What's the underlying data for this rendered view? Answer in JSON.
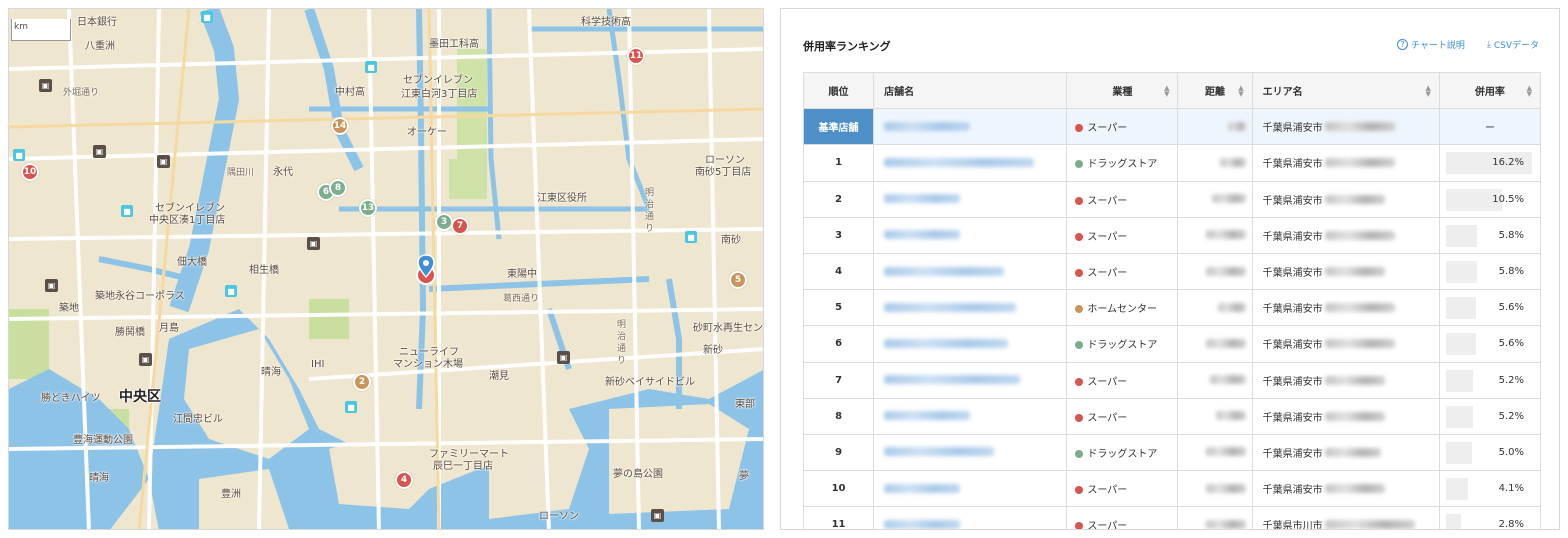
{
  "map": {
    "scale_unit": "km",
    "labels": [
      {
        "id": "nihonginko",
        "text": "日本銀行"
      },
      {
        "id": "kagaku",
        "text": "科学技術高"
      },
      {
        "id": "yaesu",
        "text": "八重洲"
      },
      {
        "id": "sotobori",
        "text": "外堀通り"
      },
      {
        "id": "sumidakou",
        "text": "墨田工科高"
      },
      {
        "id": "nakamura",
        "text": "中村高"
      },
      {
        "id": "seven1",
        "text": "セブンイレブン"
      },
      {
        "id": "seven1b",
        "text": "江東白河3丁目店"
      },
      {
        "id": "okei",
        "text": "オーケー"
      },
      {
        "id": "sumidagawa",
        "text": "隅田川"
      },
      {
        "id": "eitai",
        "text": "永代"
      },
      {
        "id": "seven2",
        "text": "セブンイレブン"
      },
      {
        "id": "seven2b",
        "text": "中央区湊1丁目店"
      },
      {
        "id": "lawson1",
        "text": "ローソン"
      },
      {
        "id": "lawson1b",
        "text": "南砂5丁目店"
      },
      {
        "id": "koto",
        "text": "江東区役所"
      },
      {
        "id": "meiji1",
        "text": "明治通り"
      },
      {
        "id": "minamisuna",
        "text": "南砂"
      },
      {
        "id": "tsukuda",
        "text": "佃大橋"
      },
      {
        "id": "aioi",
        "text": "相生橋"
      },
      {
        "id": "toyochu",
        "text": "東陽中"
      },
      {
        "id": "tsukiji",
        "text": "築地"
      },
      {
        "id": "tsukijiriver",
        "text": "築地永谷コーポラス"
      },
      {
        "id": "eitaidori",
        "text": "葛西通り"
      },
      {
        "id": "kachidoki",
        "text": "勝鬨橋"
      },
      {
        "id": "tsukishima",
        "text": "月島"
      },
      {
        "id": "sunamachi",
        "text": "砂町水再生セン"
      },
      {
        "id": "meiji2",
        "text": "明治通り"
      },
      {
        "id": "shinsuna",
        "text": "新砂"
      },
      {
        "id": "harumi",
        "text": "晴海"
      },
      {
        "id": "ihi",
        "text": "IHI"
      },
      {
        "id": "newlife",
        "text": "ニューライフ"
      },
      {
        "id": "newlifeb",
        "text": "マンション木場"
      },
      {
        "id": "shiomi",
        "text": "潮見"
      },
      {
        "id": "shinsunabay",
        "text": "新砂ベイサイドビル"
      },
      {
        "id": "kachidokiheights",
        "text": "勝どきハイツ"
      },
      {
        "id": "chuoku",
        "text": "中央区"
      },
      {
        "id": "edomi",
        "text": "江間忠ビル"
      },
      {
        "id": "toyosu",
        "text": "豊海運動公園"
      },
      {
        "id": "harumi2",
        "text": "晴海"
      },
      {
        "id": "toyosu2",
        "text": "豊洲"
      },
      {
        "id": "famima",
        "text": "ファミリーマート"
      },
      {
        "id": "famimab",
        "text": "辰巳一丁目店"
      },
      {
        "id": "yumenoshima",
        "text": "夢の島公園"
      },
      {
        "id": "tobu",
        "text": "東部"
      },
      {
        "id": "yume",
        "text": "夢"
      },
      {
        "id": "lawson2",
        "text": "ローソン"
      }
    ],
    "markers": [
      {
        "num": "11",
        "color": "#d9534f"
      },
      {
        "num": "10",
        "color": "#d9534f"
      },
      {
        "num": "14",
        "color": "#c8955a"
      },
      {
        "num": "6",
        "color": "#7cae8e"
      },
      {
        "num": "8",
        "color": "#7cae8e"
      },
      {
        "num": "13",
        "color": "#7cae8e"
      },
      {
        "num": "3",
        "color": "#7cae8e"
      },
      {
        "num": "7",
        "color": "#d9534f"
      },
      {
        "num": "5",
        "color": "#c8955a"
      },
      {
        "num": "2",
        "color": "#c8955a"
      },
      {
        "num": "4",
        "color": "#d9534f"
      }
    ]
  },
  "ranking": {
    "title": "併用率ランキング",
    "help_link": "チャート説明",
    "csv_link": "CSVデータ",
    "headers": {
      "rank": "順位",
      "store": "店舗名",
      "type": "業種",
      "distance": "距離",
      "area": "エリア名",
      "rate": "併用率"
    },
    "base_row": {
      "label": "基準店舗",
      "type": "スーパー",
      "type_color": "#d9534f",
      "area": "千葉県浦安市",
      "rate": "ー"
    },
    "rows": [
      {
        "rank": "1",
        "type": "ドラッグストア",
        "type_color": "#7cae8e",
        "area": "千葉県浦安市",
        "rate": "16.2%",
        "rate_value": 16.2
      },
      {
        "rank": "2",
        "type": "スーパー",
        "type_color": "#d9534f",
        "area": "千葉県浦安市",
        "rate": "10.5%",
        "rate_value": 10.5
      },
      {
        "rank": "3",
        "type": "スーパー",
        "type_color": "#d9534f",
        "area": "千葉県浦安市",
        "rate": "5.8%",
        "rate_value": 5.8
      },
      {
        "rank": "4",
        "type": "スーパー",
        "type_color": "#d9534f",
        "area": "千葉県浦安市",
        "rate": "5.8%",
        "rate_value": 5.8
      },
      {
        "rank": "5",
        "type": "ホームセンター",
        "type_color": "#c8955a",
        "area": "千葉県浦安市",
        "rate": "5.6%",
        "rate_value": 5.6
      },
      {
        "rank": "6",
        "type": "ドラッグストア",
        "type_color": "#7cae8e",
        "area": "千葉県浦安市",
        "rate": "5.6%",
        "rate_value": 5.6
      },
      {
        "rank": "7",
        "type": "スーパー",
        "type_color": "#d9534f",
        "area": "千葉県浦安市",
        "rate": "5.2%",
        "rate_value": 5.2
      },
      {
        "rank": "8",
        "type": "スーパー",
        "type_color": "#d9534f",
        "area": "千葉県浦安市",
        "rate": "5.2%",
        "rate_value": 5.2
      },
      {
        "rank": "9",
        "type": "ドラッグストア",
        "type_color": "#7cae8e",
        "area": "千葉県浦安市",
        "rate": "5.0%",
        "rate_value": 5.0
      },
      {
        "rank": "10",
        "type": "スーパー",
        "type_color": "#d9534f",
        "area": "千葉県浦安市",
        "rate": "4.1%",
        "rate_value": 4.1
      },
      {
        "rank": "11",
        "type": "スーパー",
        "type_color": "#d9534f",
        "area": "千葉県市川市",
        "rate": "2.8%",
        "rate_value": 2.8
      }
    ],
    "rate_max": 16.2
  }
}
